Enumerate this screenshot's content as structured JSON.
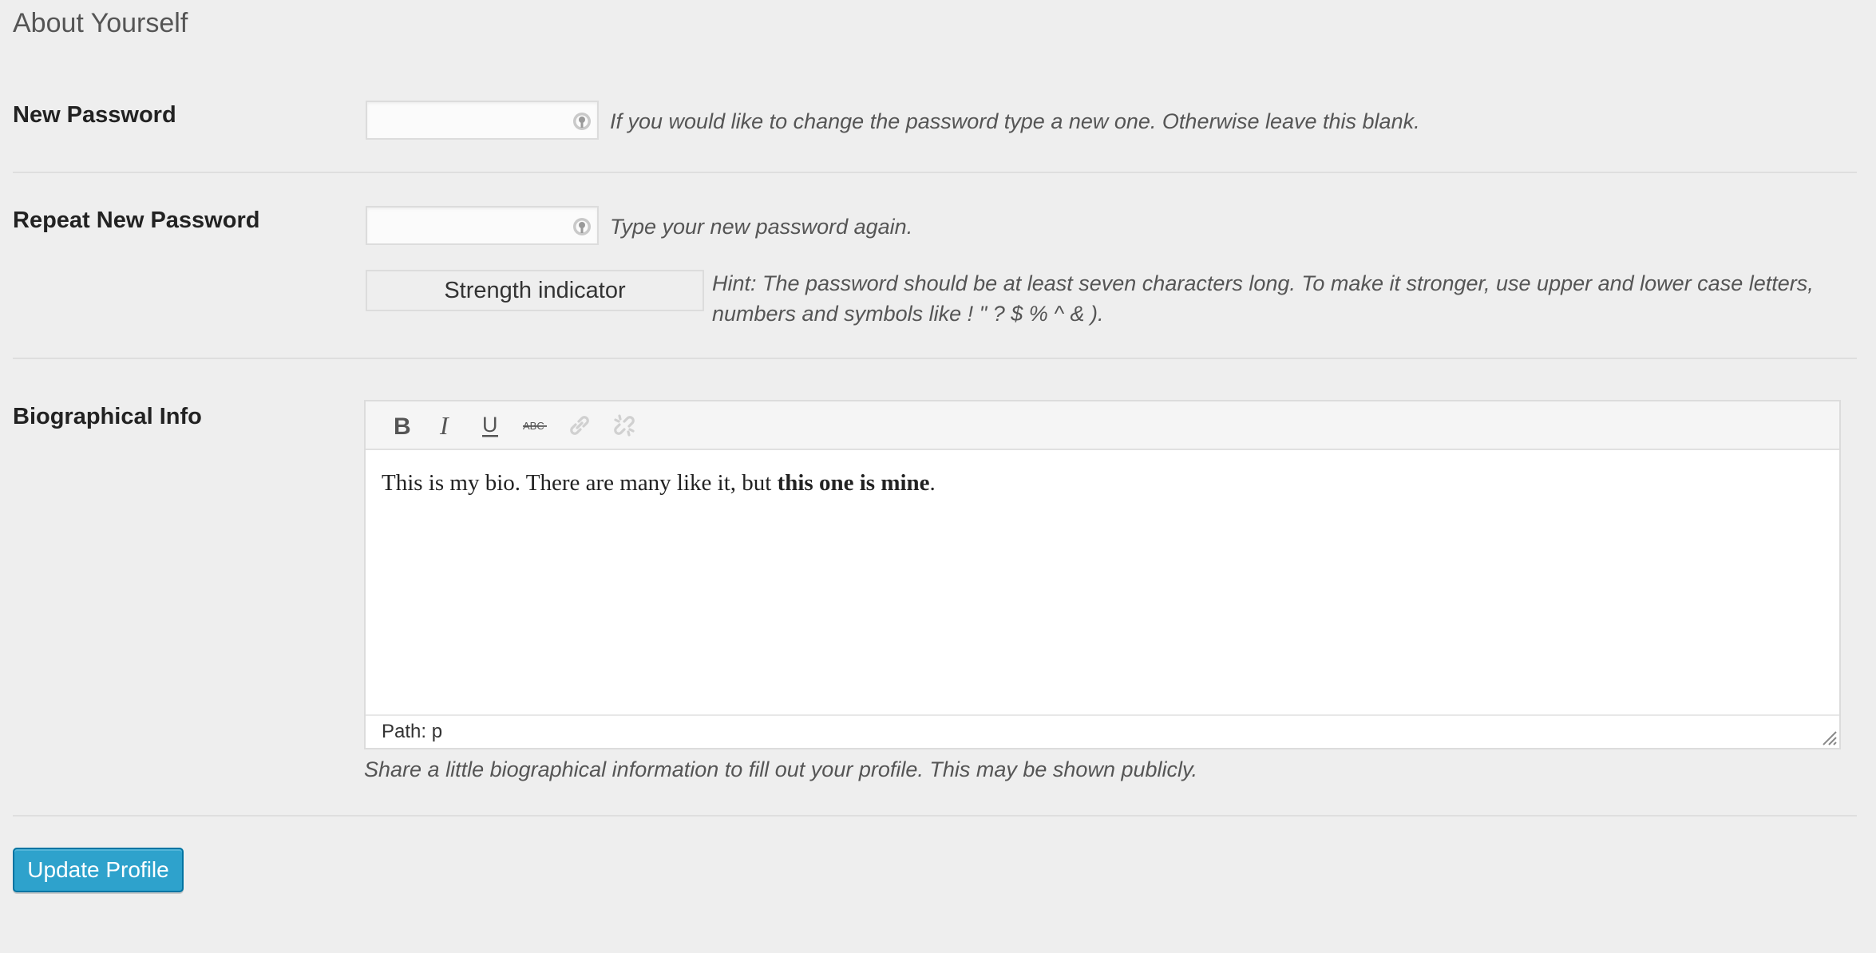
{
  "section": {
    "title": "About Yourself"
  },
  "new_password": {
    "label": "New Password",
    "value": "",
    "description": "If you would like to change the password type a new one. Otherwise leave this blank.",
    "icon": "key-icon"
  },
  "repeat_password": {
    "label": "Repeat New Password",
    "value": "",
    "description": "Type your new password again.",
    "icon": "key-icon"
  },
  "strength": {
    "indicator_label": "Strength indicator",
    "hint": "Hint: The password should be at least seven characters long. To make it stronger, use upper and lower case letters, numbers and symbols like ! \" ? $ % ^ & )."
  },
  "bio": {
    "label": "Biographical Info",
    "toolbar": [
      {
        "name": "bold-icon",
        "glyph": "B"
      },
      {
        "name": "italic-icon",
        "glyph": "I"
      },
      {
        "name": "underline-icon",
        "glyph": "U"
      },
      {
        "name": "strikethrough-icon",
        "glyph": "ABC"
      },
      {
        "name": "link-icon",
        "glyph": ""
      },
      {
        "name": "unlink-icon",
        "glyph": ""
      }
    ],
    "content_plain": "This is my bio. There are many like it, but ",
    "content_bold": "this one is mine",
    "content_end": ".",
    "path_label": "Path: p",
    "description": "Share a little biographical information to fill out your profile. This may be shown publicly."
  },
  "actions": {
    "update_label": "Update Profile"
  },
  "colors": {
    "background": "#eeeeee",
    "primary_button": "#2ea2cc",
    "primary_button_border": "#0074a2",
    "divider": "#dedede"
  }
}
